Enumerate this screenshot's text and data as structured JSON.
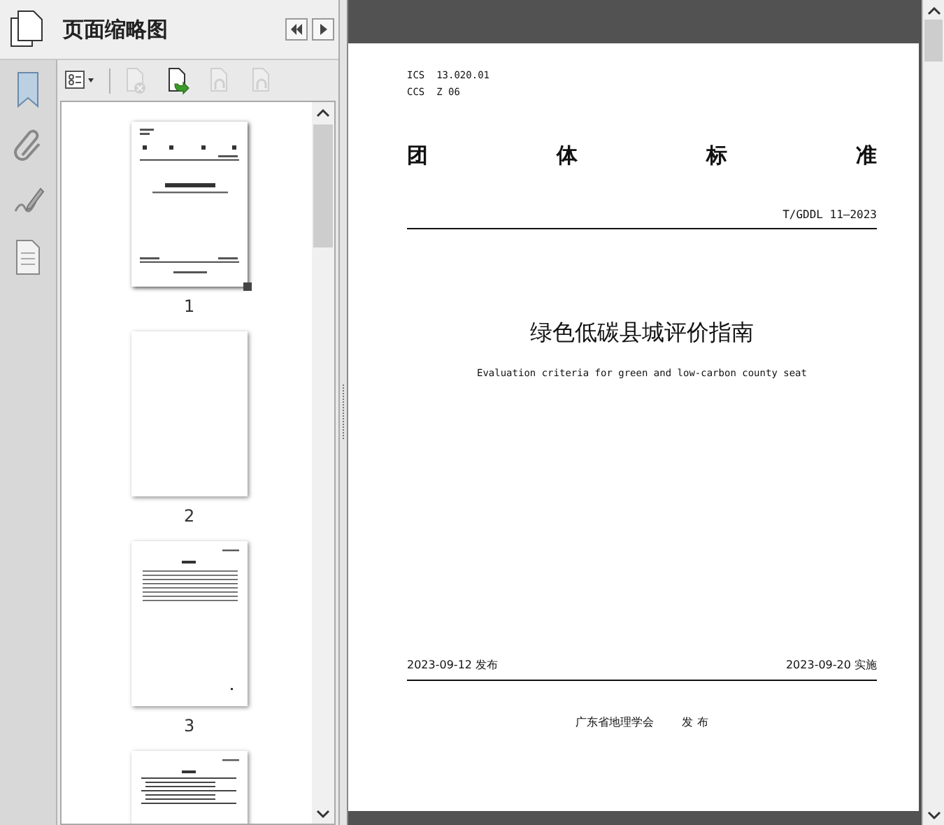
{
  "panel": {
    "title": "页面缩略图"
  },
  "toolbar": [
    {
      "kind": "options",
      "disabled": false
    },
    {
      "kind": "delete",
      "disabled": true
    },
    {
      "kind": "insert",
      "disabled": false
    },
    {
      "kind": "rotate-left",
      "disabled": true
    },
    {
      "kind": "rotate-right",
      "disabled": true
    }
  ],
  "thumbnails": [
    {
      "label": "1",
      "kind": "cover",
      "selected": true
    },
    {
      "label": "2",
      "kind": "blank",
      "selected": false
    },
    {
      "label": "3",
      "kind": "contents",
      "selected": false
    },
    {
      "kind": "text",
      "selected": false
    }
  ],
  "document": {
    "codes": [
      "ICS  13.020.01",
      "CCS  Z 06"
    ],
    "category": [
      "团",
      "体",
      "标",
      "准"
    ],
    "number": "T/GDDL 11—2023",
    "title": "绿色低碳县城评价指南",
    "subtitle": "Evaluation criteria for green and low-carbon county seat",
    "issued": "2023-09-12 发布",
    "effective": "2023-09-20 实施",
    "publisher": "广东省地理学会",
    "publish_word": "发 布"
  }
}
